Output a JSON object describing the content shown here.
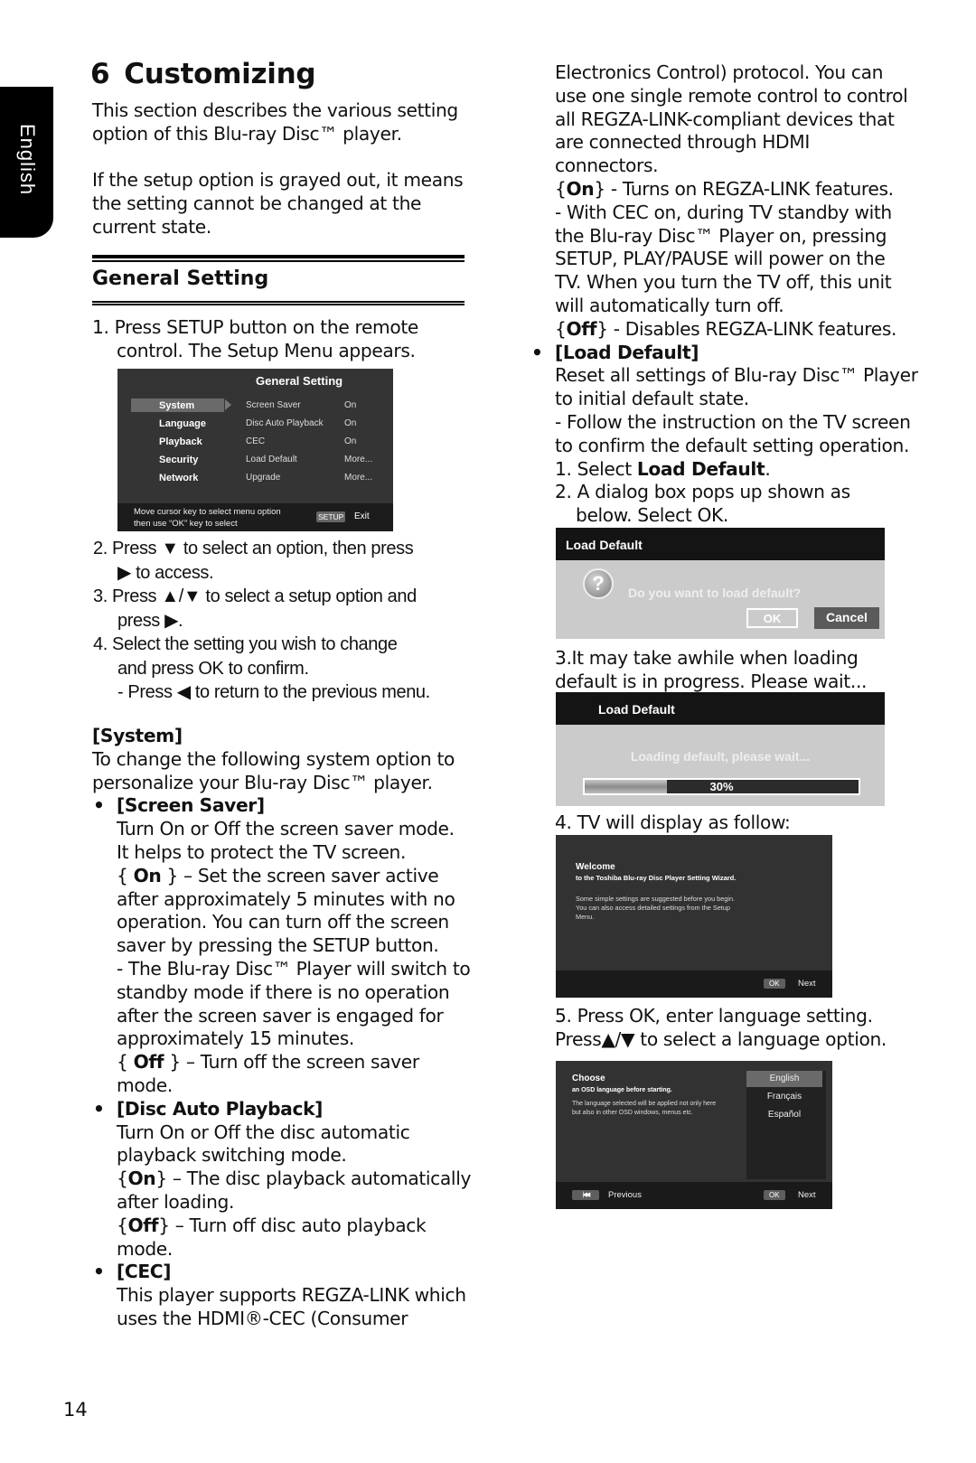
{
  "side_tab": {
    "label": "English"
  },
  "chapter": {
    "number": "6",
    "title": "Customizing"
  },
  "intro": {
    "p1": [
      "This section describes the various setting",
      "option of this Blu-ray Disc™ player."
    ],
    "p2": [
      "If the setup option is grayed out, it means",
      "the setting cannot be changed at the",
      "current state."
    ]
  },
  "section_title": "General Setting",
  "steps": {
    "s1": [
      "1. Press SETUP button on the remote",
      "control. The Setup Menu appears."
    ],
    "s2a": "2. Press ▼ to select an option, then press",
    "s2b": "▶ to access.",
    "s3a": "3. Press ▲/▼ to select a setup option and",
    "s3b": "press ▶.",
    "s4a": "4. Select the setting you wish to change",
    "s4b": "and press OK to confirm.",
    "s4c": "- Press ◀ to return to the previous menu."
  },
  "setup_menu": {
    "title": "General Setting",
    "categories": [
      "System",
      "Language",
      "Playback",
      "Security",
      "Network"
    ],
    "selected_category": "System",
    "options": [
      {
        "name": "Screen Saver",
        "value": "On"
      },
      {
        "name": "Disc Auto Playback",
        "value": "On"
      },
      {
        "name": "CEC",
        "value": "On"
      },
      {
        "name": "Load Default",
        "value": "More..."
      },
      {
        "name": "Upgrade",
        "value": "More..."
      }
    ],
    "hint": [
      "Move cursor key to select menu option",
      "then use “OK” key to select"
    ],
    "key_label": "SETUP",
    "exit_label": "Exit"
  },
  "system": {
    "heading": "[System]",
    "desc": [
      "To change the following system option to",
      "personalize your Blu-ray Disc™ player."
    ],
    "screen_saver": {
      "heading": "[Screen Saver]",
      "lines": [
        "Turn On or Off the screen saver mode.",
        "It helps to protect the TV screen."
      ],
      "on_label": "On",
      "on_text": [
        "} – Set the screen saver active",
        "after approximately 5 minutes with no",
        "operation. You can turn off the screen",
        "saver by pressing the SETUP button.",
        "- The Blu-ray Disc™ Player will switch to",
        "standby mode if there is no operation",
        "after the screen saver is engaged for",
        "approximately 15 minutes."
      ],
      "off_label": "Off",
      "off_text": [
        "} – Turn off the screen saver",
        "mode."
      ]
    },
    "disc_auto": {
      "heading": "[Disc Auto Playback]",
      "lines": [
        "Turn On or Off the disc automatic",
        "playback switching mode."
      ],
      "on_label": "On",
      "on_text": [
        "} – The disc playback automatically",
        "after loading."
      ],
      "off_label": "Off",
      "off_text": [
        "} – Turn off disc auto playback",
        "mode."
      ]
    },
    "cec": {
      "heading": "[CEC]",
      "lines": [
        "This player supports REGZA-LINK which",
        "uses the HDMI®-CEC (Consumer",
        "Electronics Control) protocol. You can",
        "use one single remote control to control",
        "all REGZA-LINK-compliant devices that",
        "are connected through HDMI",
        "connectors."
      ],
      "on_label": "On",
      "on_text": "} - Turns on REGZA-LINK features.",
      "on_more": [
        "- With CEC on, during TV standby with",
        "the Blu-ray Disc™ Player on, pressing",
        "SETUP, PLAY/PAUSE will  power on the",
        "TV. When you turn the TV off, this unit",
        "will automatically turn off."
      ],
      "off_label": "Off",
      "off_text": "} - Disables REGZA-LINK features."
    },
    "load_default": {
      "heading": "[Load Default]",
      "lines": [
        "Reset all settings of Blu-ray Disc™ Player",
        "to initial default state.",
        "- Follow the instruction on the TV screen",
        "to confirm the default setting operation."
      ],
      "step1_prefix": "1. Select ",
      "step1_bold": "Load Default",
      "step1_suffix": ".",
      "step2": [
        "2. A dialog box pops up shown as",
        "below. Select OK."
      ],
      "step3": [
        "3.It may take awhile when loading",
        "default is in progress. Please wait..."
      ],
      "step4": "4. TV will display as follow:",
      "step5": [
        "5. Press OK, enter language setting.",
        "Press▲/▼ to select a language option."
      ]
    }
  },
  "dialog": {
    "title": "Load Default",
    "icon": "question-icon",
    "message": "Do you want to load default?",
    "ok_label": "OK",
    "cancel_label": "Cancel"
  },
  "progress_screen": {
    "title": "Load Default",
    "message": "Loading default, please wait...",
    "progress_percent": 30,
    "progress_label": "30%"
  },
  "welcome_screen": {
    "title": "Welcome",
    "subtitle": "to the Toshiba Blu-ray Disc Player Setting Wizard.",
    "body": "Some simple settings are suggested before you begin. You can also access detailed settings from the Setup Menu.",
    "ok_key": "OK",
    "next_label": "Next"
  },
  "language_screen": {
    "title": "Choose",
    "subtitle": "an OSD language before starting.",
    "body": "The language selected will be applied not only here but also in other OSD windows, menus etc.",
    "languages": [
      "English",
      "Français",
      "Español"
    ],
    "selected": "English",
    "prev_key": "|◀◀",
    "prev_label": "Previous",
    "ok_key": "OK",
    "next_label": "Next"
  },
  "page_number": "14"
}
